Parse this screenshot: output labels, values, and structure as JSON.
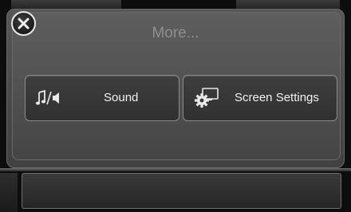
{
  "screen": {
    "title": "More..."
  },
  "close": {
    "icon": "close-icon"
  },
  "buttons": [
    {
      "label": "Sound",
      "icon": "sound-icon"
    },
    {
      "label": "Screen Settings",
      "icon": "screen-settings-icon"
    }
  ],
  "colors": {
    "background": "#0d0d0d",
    "panel": "#4f4f4f",
    "button": "#343434",
    "text": "#f2f2f2",
    "title": "#8f8f8f"
  }
}
